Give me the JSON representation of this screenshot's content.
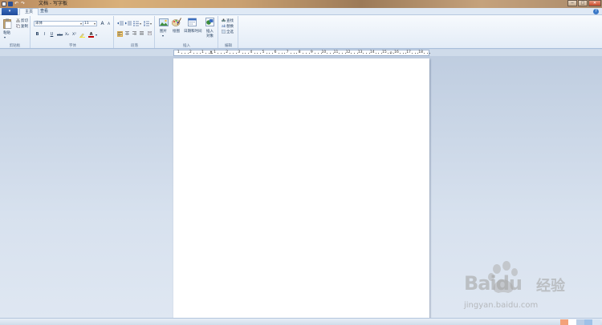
{
  "window": {
    "title": "文档 - 写字板",
    "minimize_glyph": "─",
    "maximize_glyph": "□",
    "close_glyph": "✕"
  },
  "quick_access": {
    "undo_glyph": "↶",
    "redo_glyph": "↷"
  },
  "tabs": {
    "file_label": "▾",
    "items": [
      {
        "label": "主页"
      },
      {
        "label": "查看"
      }
    ]
  },
  "help": {
    "glyph": "?"
  },
  "ribbon": {
    "clipboard": {
      "label": "剪贴板",
      "paste": "粘贴",
      "cut": "剪切",
      "copy": "复制"
    },
    "font": {
      "label": "字体",
      "family_value": "宋体",
      "size_value": "11",
      "grow": "A",
      "shrink": "A",
      "bold": "B",
      "italic": "I",
      "underline": "U",
      "strike": "abc",
      "subscript": "X₂",
      "superscript": "X²",
      "color": "A"
    },
    "paragraph": {
      "label": "段落"
    },
    "insert": {
      "label": "插入",
      "picture": "图片",
      "paint": "绘图",
      "datetime": "日期和时间",
      "object_line1": "插入",
      "object_line2": "对象"
    },
    "editing": {
      "label": "编辑",
      "find": "查找",
      "replace": "替换",
      "select_all": "全选"
    }
  },
  "ruler": {
    "numbers": [
      "1",
      "2",
      "1",
      "1",
      "2",
      "3",
      "4",
      "5",
      "6",
      "7",
      "8",
      "9",
      "10",
      "11",
      "12",
      "13",
      "14",
      "15",
      "16",
      "17",
      "18"
    ]
  },
  "watermark": {
    "brand": "Bai",
    "brand2": "du",
    "cn": "经验",
    "url": "jingyan.baidu.com"
  },
  "colors": {
    "accent": "#2b579a",
    "ribbon_bg": "#eef3fa",
    "workspace": "#c9d6e7",
    "watermark": "#b0b0b0"
  }
}
